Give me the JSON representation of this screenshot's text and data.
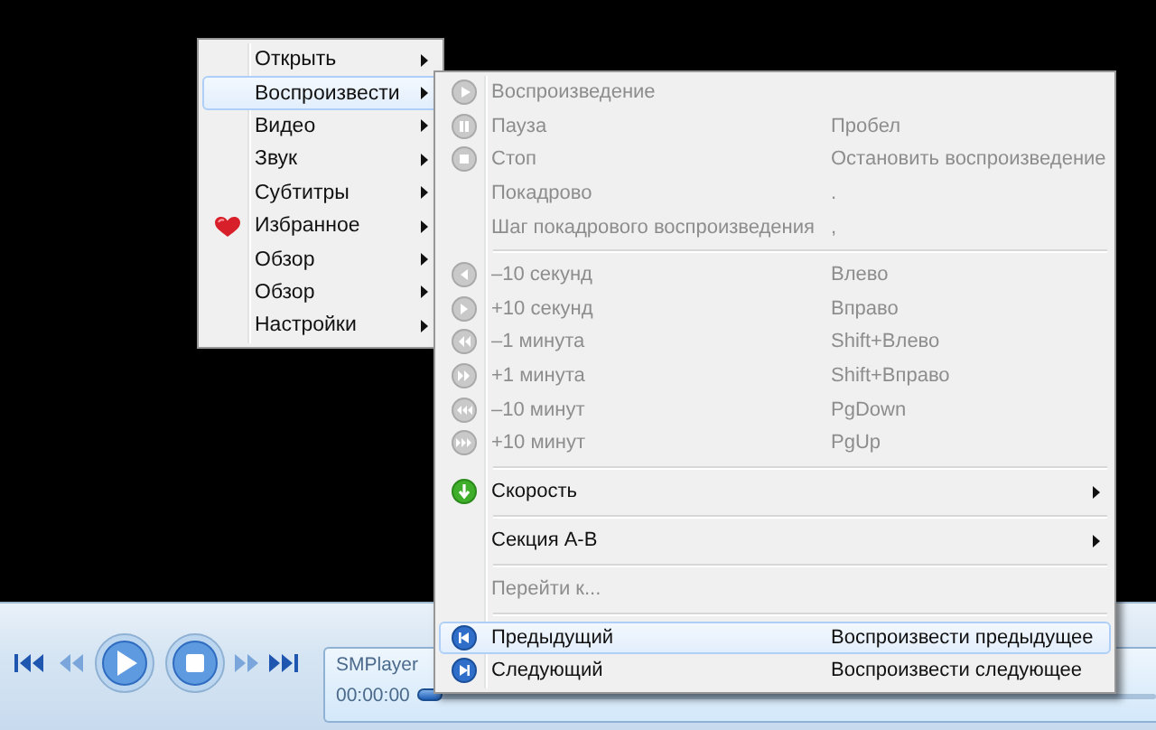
{
  "main_menu": {
    "items": [
      {
        "label": "Открыть",
        "selected": false,
        "has_submenu": true
      },
      {
        "label": "Воспроизвести",
        "selected": true,
        "has_submenu": true
      },
      {
        "label": "Видео",
        "selected": false,
        "has_submenu": true
      },
      {
        "label": "Звук",
        "selected": false,
        "has_submenu": true
      },
      {
        "label": "Субтитры",
        "selected": false,
        "has_submenu": true
      },
      {
        "label": "Избранное",
        "selected": false,
        "has_submenu": true
      },
      {
        "label": "Обзор",
        "selected": false,
        "has_submenu": true
      },
      {
        "label": "Обзор",
        "selected": false,
        "has_submenu": true
      },
      {
        "label": "Настройки",
        "selected": false,
        "has_submenu": true
      }
    ]
  },
  "submenu": {
    "groups": [
      [
        {
          "label": "Воспроизведение",
          "disabled": true,
          "selected": false
        },
        {
          "label": "Пауза",
          "shortcut": "Пробел",
          "disabled": true,
          "selected": false
        },
        {
          "label": "Стоп",
          "shortcut": "Остановить воспроизведение",
          "disabled": true,
          "selected": false
        },
        {
          "label": "Покадрово",
          "shortcut": ".",
          "disabled": true,
          "selected": false
        },
        {
          "label": "Шаг покадрового воспроизведения",
          "shortcut": ",",
          "disabled": true,
          "selected": false
        }
      ],
      [
        {
          "label": "–10 секунд",
          "shortcut": "Влево",
          "disabled": true,
          "selected": false
        },
        {
          "label": "+10 секунд",
          "shortcut": "Вправо",
          "disabled": true,
          "selected": false
        },
        {
          "label": "–1 минута",
          "shortcut": "Shift+Влево",
          "disabled": true,
          "selected": false
        },
        {
          "label": "+1 минута",
          "shortcut": "Shift+Вправо",
          "disabled": true,
          "selected": false
        },
        {
          "label": "–10 минут",
          "shortcut": "PgDown",
          "disabled": true,
          "selected": false
        },
        {
          "label": "+10 минут",
          "shortcut": "PgUp",
          "disabled": true,
          "selected": false
        }
      ],
      [
        {
          "label": "Скорость",
          "disabled": false,
          "selected": false,
          "has_submenu": true
        }
      ],
      [
        {
          "label": "Секция A-B",
          "disabled": false,
          "selected": false,
          "has_submenu": true
        }
      ],
      [
        {
          "label": "Перейти к...",
          "disabled": true,
          "selected": false
        }
      ],
      [
        {
          "label": "Предыдущий",
          "shortcut": "Воспроизвести предыдущее",
          "disabled": false,
          "selected": true
        },
        {
          "label": "Следующий",
          "shortcut": "Воспроизвести следующее",
          "disabled": false,
          "selected": false
        }
      ]
    ]
  },
  "player": {
    "display": {
      "title": "SMPlayer",
      "time": "00:00:00",
      "level": 0
    }
  }
}
